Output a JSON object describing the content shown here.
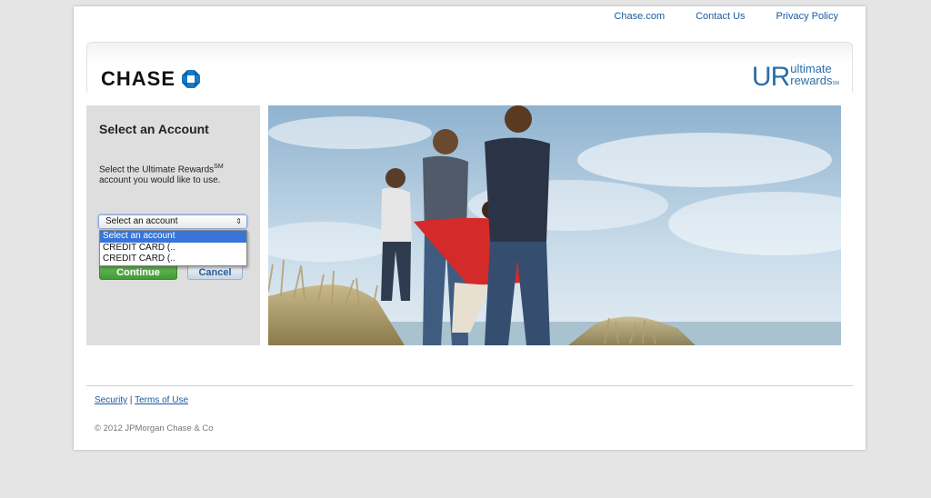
{
  "top_links": {
    "chase": "Chase.com",
    "contact": "Contact Us",
    "privacy": "Privacy Policy"
  },
  "header": {
    "brand": "CHASE",
    "rewards_mark": "UR",
    "rewards_line1": "ultimate",
    "rewards_line2": "rewards",
    "rewards_sm": "SM"
  },
  "account_panel": {
    "title": "Select an Account",
    "description": "Select the Ultimate Rewards",
    "description_sup": "SM",
    "description_rest": " account you would like to use.",
    "select_value": "Select an account",
    "options": [
      "Select an account",
      "CREDIT CARD (..",
      "CREDIT CARD (.."
    ],
    "continue_label": "Continue",
    "cancel_label": "Cancel"
  },
  "footer": {
    "security": "Security",
    "separator": " | ",
    "terms": "Terms of Use",
    "copyright": "© 2012 JPMorgan Chase & Co"
  },
  "colors": {
    "link": "#1a5a9e",
    "chase_blue": "#117aca",
    "continue_green": "#4aa33f"
  }
}
